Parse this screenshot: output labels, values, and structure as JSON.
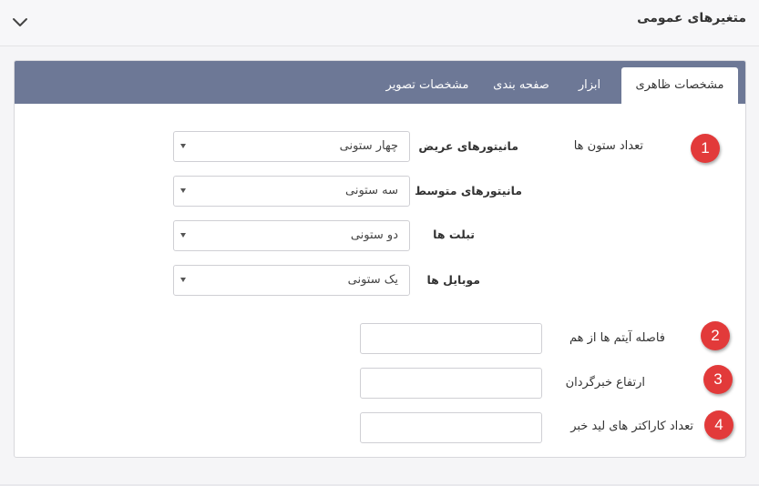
{
  "header": {
    "title": "متغیرهای عمومی",
    "chevron": "chevron-down-icon"
  },
  "tabs": [
    {
      "label": "مشخصات ظاهری",
      "active": true
    },
    {
      "label": "ابزار",
      "active": false
    },
    {
      "label": "صفحه بندی",
      "active": false
    },
    {
      "label": "مشخصات تصویر",
      "active": false
    }
  ],
  "columns": {
    "label": "تعداد ستون ها",
    "rows": [
      {
        "device": "مانیتورهای عریض",
        "value": "چهار ستونی"
      },
      {
        "device": "مانیتورهای متوسط",
        "value": "سه ستونی"
      },
      {
        "device": "تبلت ها",
        "value": "دو ستونی"
      },
      {
        "device": "موبایل ها",
        "value": "یک ستونی"
      }
    ]
  },
  "fields": {
    "item_spacing": {
      "label": "فاصله آیتم ها از هم",
      "value": ""
    },
    "ticker_height": {
      "label": "ارتفاع خبرگردان",
      "value": ""
    },
    "lead_chars": {
      "label": "تعداد کاراکتر های لید خبر",
      "value": ""
    }
  },
  "badges": [
    "1",
    "2",
    "3",
    "4"
  ],
  "colors": {
    "tabbar": "#6d7896",
    "badge": "#e23a3a"
  }
}
